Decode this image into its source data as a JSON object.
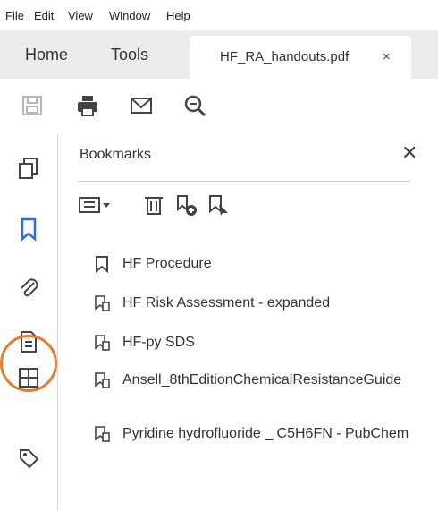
{
  "menu": [
    "File",
    "Edit",
    "View",
    "Window",
    "Help"
  ],
  "tabs": {
    "home": "Home",
    "tools": "Tools",
    "document": "HF_RA_handouts.pdf",
    "close_glyph": "×"
  },
  "toolbar": {
    "icons": [
      "save-icon",
      "print-icon",
      "email-icon",
      "zoom-icon"
    ]
  },
  "rail": {
    "icons": [
      "pages-icon",
      "bookmark-icon",
      "attachment-icon",
      "document-icon",
      "layers-icon",
      "tag-icon"
    ]
  },
  "panel": {
    "title": "Bookmarks",
    "close_glyph": "✕",
    "bookmarks": [
      "HF Procedure",
      "HF Risk Assessment - expanded",
      "HF-py SDS",
      "Ansell_8thEditionChemicalResistanceGuide",
      "Pyridine hydrofluoride _ C5H6FN - PubChem"
    ]
  },
  "colors": {
    "highlight": "#e87b2e",
    "accent": "#2b6fd1"
  }
}
